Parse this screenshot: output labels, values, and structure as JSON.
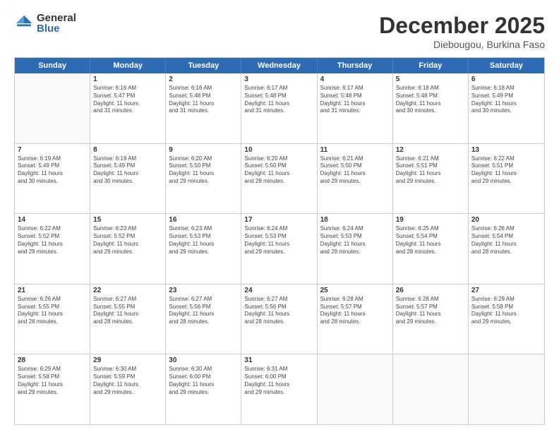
{
  "logo": {
    "general": "General",
    "blue": "Blue"
  },
  "header": {
    "title": "December 2025",
    "subtitle": "Diebougou, Burkina Faso"
  },
  "days": [
    "Sunday",
    "Monday",
    "Tuesday",
    "Wednesday",
    "Thursday",
    "Friday",
    "Saturday"
  ],
  "weeks": [
    [
      {
        "day": "",
        "empty": true,
        "lines": []
      },
      {
        "day": "1",
        "lines": [
          "Sunrise: 6:16 AM",
          "Sunset: 5:47 PM",
          "Daylight: 11 hours",
          "and 31 minutes."
        ]
      },
      {
        "day": "2",
        "lines": [
          "Sunrise: 6:16 AM",
          "Sunset: 5:48 PM",
          "Daylight: 11 hours",
          "and 31 minutes."
        ]
      },
      {
        "day": "3",
        "lines": [
          "Sunrise: 6:17 AM",
          "Sunset: 5:48 PM",
          "Daylight: 11 hours",
          "and 31 minutes."
        ]
      },
      {
        "day": "4",
        "lines": [
          "Sunrise: 6:17 AM",
          "Sunset: 5:48 PM",
          "Daylight: 11 hours",
          "and 31 minutes."
        ]
      },
      {
        "day": "5",
        "lines": [
          "Sunrise: 6:18 AM",
          "Sunset: 5:48 PM",
          "Daylight: 11 hours",
          "and 30 minutes."
        ]
      },
      {
        "day": "6",
        "lines": [
          "Sunrise: 6:18 AM",
          "Sunset: 5:49 PM",
          "Daylight: 11 hours",
          "and 30 minutes."
        ]
      }
    ],
    [
      {
        "day": "7",
        "lines": [
          "Sunrise: 6:19 AM",
          "Sunset: 5:49 PM",
          "Daylight: 11 hours",
          "and 30 minutes."
        ]
      },
      {
        "day": "8",
        "lines": [
          "Sunrise: 6:19 AM",
          "Sunset: 5:49 PM",
          "Daylight: 11 hours",
          "and 30 minutes."
        ]
      },
      {
        "day": "9",
        "lines": [
          "Sunrise: 6:20 AM",
          "Sunset: 5:50 PM",
          "Daylight: 11 hours",
          "and 29 minutes."
        ]
      },
      {
        "day": "10",
        "lines": [
          "Sunrise: 6:20 AM",
          "Sunset: 5:50 PM",
          "Daylight: 11 hours",
          "and 29 minutes."
        ]
      },
      {
        "day": "11",
        "lines": [
          "Sunrise: 6:21 AM",
          "Sunset: 5:50 PM",
          "Daylight: 11 hours",
          "and 29 minutes."
        ]
      },
      {
        "day": "12",
        "lines": [
          "Sunrise: 6:21 AM",
          "Sunset: 5:51 PM",
          "Daylight: 11 hours",
          "and 29 minutes."
        ]
      },
      {
        "day": "13",
        "lines": [
          "Sunrise: 6:22 AM",
          "Sunset: 5:51 PM",
          "Daylight: 11 hours",
          "and 29 minutes."
        ]
      }
    ],
    [
      {
        "day": "14",
        "lines": [
          "Sunrise: 6:22 AM",
          "Sunset: 5:52 PM",
          "Daylight: 11 hours",
          "and 29 minutes."
        ]
      },
      {
        "day": "15",
        "lines": [
          "Sunrise: 6:23 AM",
          "Sunset: 5:52 PM",
          "Daylight: 11 hours",
          "and 29 minutes."
        ]
      },
      {
        "day": "16",
        "lines": [
          "Sunrise: 6:23 AM",
          "Sunset: 5:53 PM",
          "Daylight: 11 hours",
          "and 29 minutes."
        ]
      },
      {
        "day": "17",
        "lines": [
          "Sunrise: 6:24 AM",
          "Sunset: 5:53 PM",
          "Daylight: 11 hours",
          "and 29 minutes."
        ]
      },
      {
        "day": "18",
        "lines": [
          "Sunrise: 6:24 AM",
          "Sunset: 5:53 PM",
          "Daylight: 11 hours",
          "and 28 minutes."
        ]
      },
      {
        "day": "19",
        "lines": [
          "Sunrise: 6:25 AM",
          "Sunset: 5:54 PM",
          "Daylight: 11 hours",
          "and 28 minutes."
        ]
      },
      {
        "day": "20",
        "lines": [
          "Sunrise: 6:26 AM",
          "Sunset: 5:54 PM",
          "Daylight: 11 hours",
          "and 28 minutes."
        ]
      }
    ],
    [
      {
        "day": "21",
        "lines": [
          "Sunrise: 6:26 AM",
          "Sunset: 5:55 PM",
          "Daylight: 11 hours",
          "and 28 minutes."
        ]
      },
      {
        "day": "22",
        "lines": [
          "Sunrise: 6:27 AM",
          "Sunset: 5:55 PM",
          "Daylight: 11 hours",
          "and 28 minutes."
        ]
      },
      {
        "day": "23",
        "lines": [
          "Sunrise: 6:27 AM",
          "Sunset: 5:56 PM",
          "Daylight: 11 hours",
          "and 28 minutes."
        ]
      },
      {
        "day": "24",
        "lines": [
          "Sunrise: 6:27 AM",
          "Sunset: 5:56 PM",
          "Daylight: 11 hours",
          "and 28 minutes."
        ]
      },
      {
        "day": "25",
        "lines": [
          "Sunrise: 6:28 AM",
          "Sunset: 5:57 PM",
          "Daylight: 11 hours",
          "and 28 minutes."
        ]
      },
      {
        "day": "26",
        "lines": [
          "Sunrise: 6:28 AM",
          "Sunset: 5:57 PM",
          "Daylight: 11 hours",
          "and 29 minutes."
        ]
      },
      {
        "day": "27",
        "lines": [
          "Sunrise: 6:29 AM",
          "Sunset: 5:58 PM",
          "Daylight: 11 hours",
          "and 29 minutes."
        ]
      }
    ],
    [
      {
        "day": "28",
        "lines": [
          "Sunrise: 6:29 AM",
          "Sunset: 5:58 PM",
          "Daylight: 11 hours",
          "and 29 minutes."
        ]
      },
      {
        "day": "29",
        "lines": [
          "Sunrise: 6:30 AM",
          "Sunset: 5:59 PM",
          "Daylight: 11 hours",
          "and 29 minutes."
        ]
      },
      {
        "day": "30",
        "lines": [
          "Sunrise: 6:30 AM",
          "Sunset: 6:00 PM",
          "Daylight: 11 hours",
          "and 29 minutes."
        ]
      },
      {
        "day": "31",
        "lines": [
          "Sunrise: 6:31 AM",
          "Sunset: 6:00 PM",
          "Daylight: 11 hours",
          "and 29 minutes."
        ]
      },
      {
        "day": "",
        "empty": true,
        "lines": []
      },
      {
        "day": "",
        "empty": true,
        "lines": []
      },
      {
        "day": "",
        "empty": true,
        "lines": []
      }
    ]
  ]
}
